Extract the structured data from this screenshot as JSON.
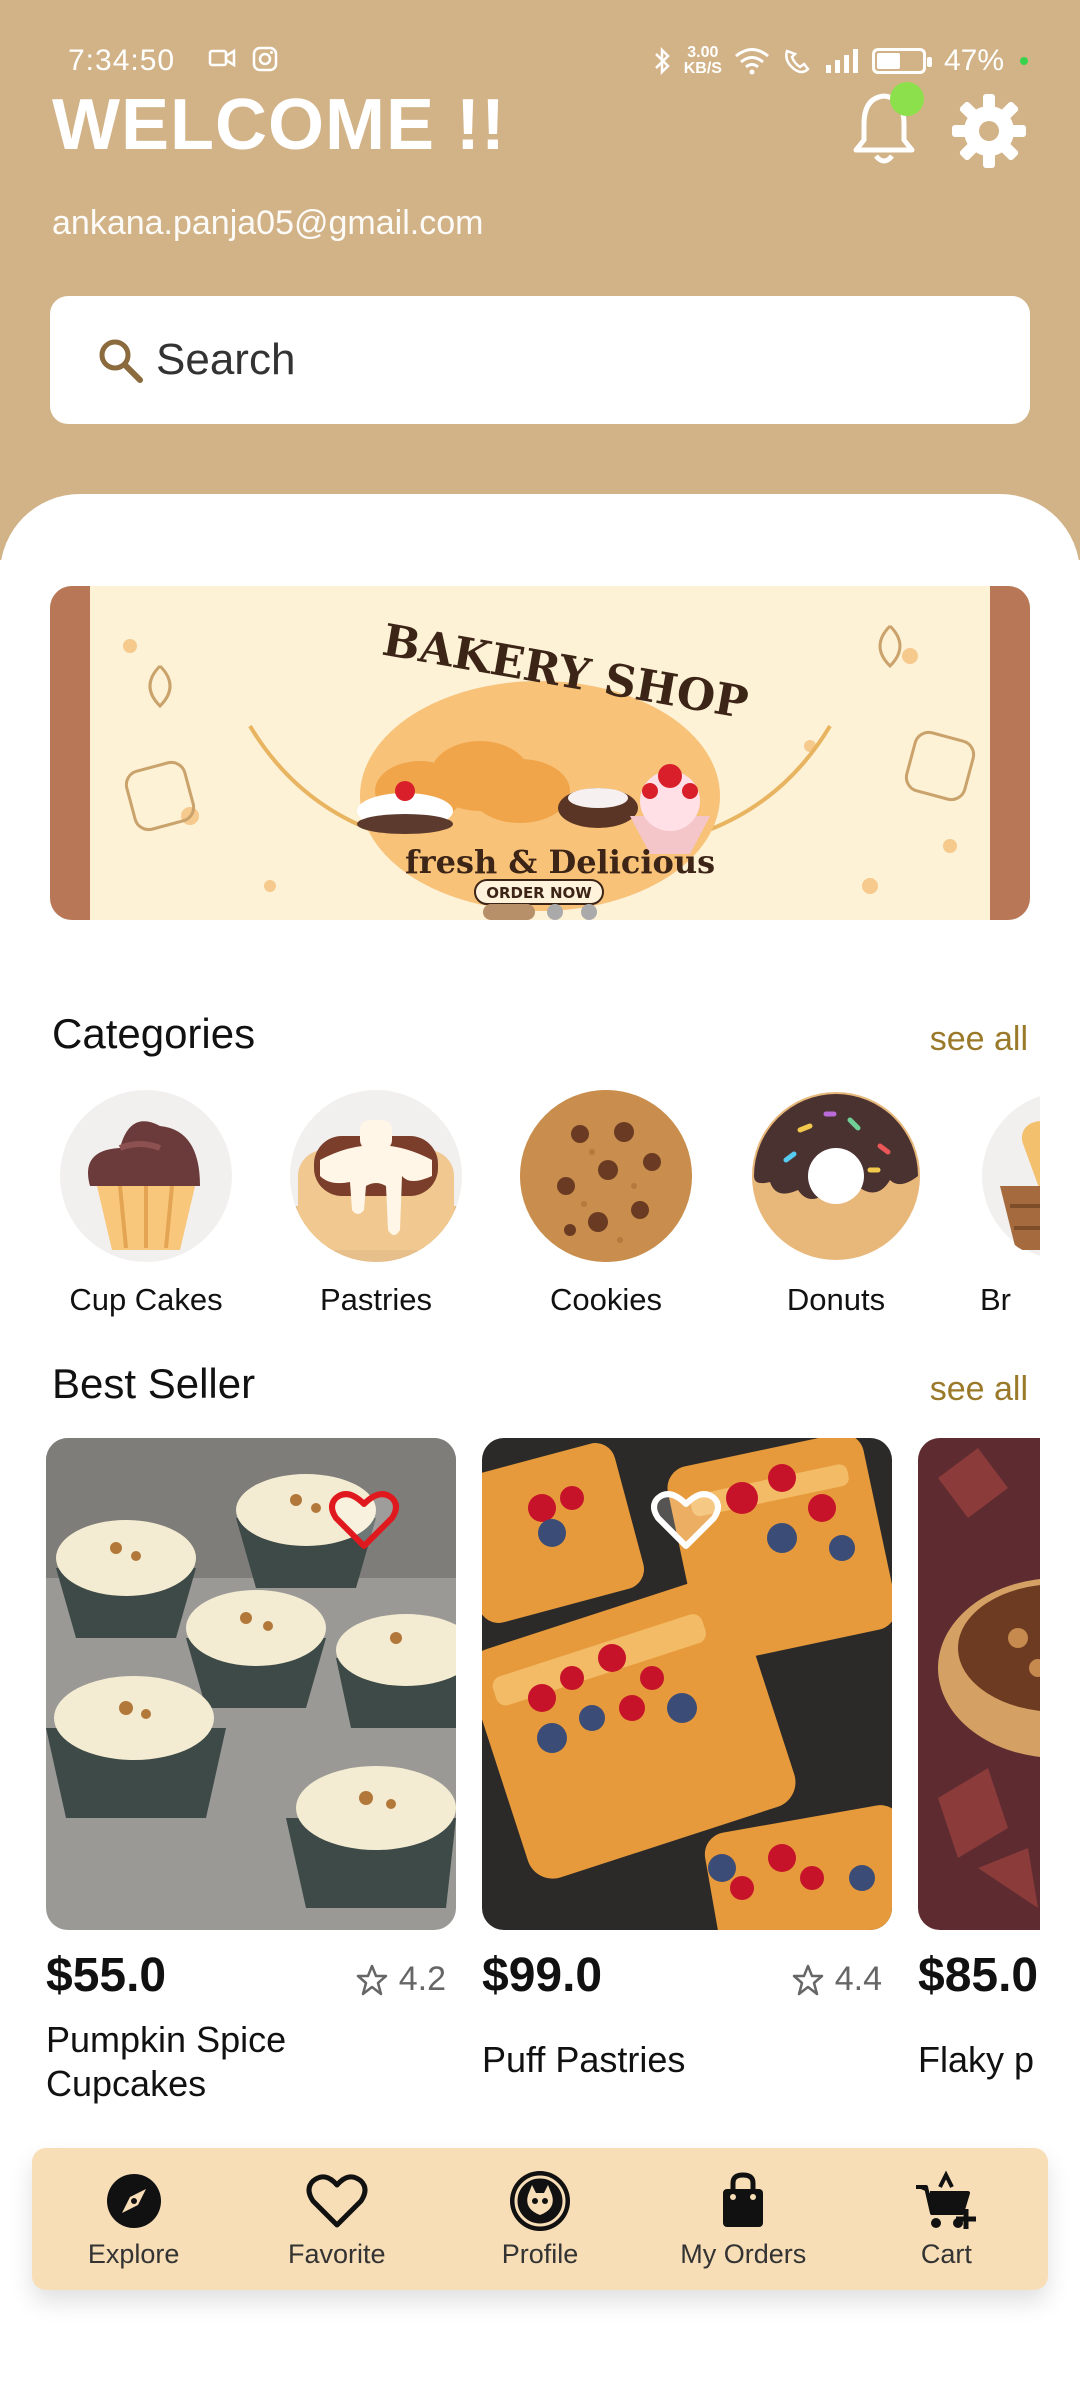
{
  "status_bar": {
    "time": "7:34:50",
    "speed_top": "3.00",
    "speed_unit": "KB/S",
    "battery": "47%",
    "battery_level": 0.47
  },
  "header": {
    "title": "WELCOME !!",
    "email": "ankana.panja05@gmail.com"
  },
  "search": {
    "placeholder": "Search"
  },
  "banner": {
    "title": "BAKERY SHOP",
    "tagline": "fresh & Delicious",
    "cta": "ORDER NOW",
    "slides": 3,
    "active_slide": 0
  },
  "categories": {
    "title": "Categories",
    "see_all": "see all",
    "items": [
      {
        "label": "Cup Cakes",
        "icon": "cupcake-icon"
      },
      {
        "label": "Pastries",
        "icon": "pastry-icon"
      },
      {
        "label": "Cookies",
        "icon": "cookie-icon"
      },
      {
        "label": "Donuts",
        "icon": "donut-icon"
      },
      {
        "label": "Br",
        "icon": "bread-basket-icon"
      }
    ]
  },
  "best_seller": {
    "title": "Best Seller",
    "see_all": "see all",
    "items": [
      {
        "price": "$55.0",
        "rating": "4.2",
        "name": "Pumpkin Spice Cupcakes",
        "favorite": true
      },
      {
        "price": "$99.0",
        "rating": "4.4",
        "name": "Puff Pastries",
        "favorite": false
      },
      {
        "price": "$85.0",
        "rating": "",
        "name": "Flaky p",
        "favorite": false
      }
    ]
  },
  "nav": {
    "items": [
      {
        "label": "Explore",
        "icon": "compass-icon"
      },
      {
        "label": "Favorite",
        "icon": "heart-icon"
      },
      {
        "label": "Profile",
        "icon": "profile-icon"
      },
      {
        "label": "My Orders",
        "icon": "shopping-bag-icon"
      },
      {
        "label": "Cart",
        "icon": "cart-add-icon"
      }
    ]
  },
  "colors": {
    "header_bg": "#d2b387",
    "accent": "#9a7a2a",
    "nav_bg": "#f7deb6",
    "badge": "#8be04b",
    "heart_active": "#e0191e"
  }
}
